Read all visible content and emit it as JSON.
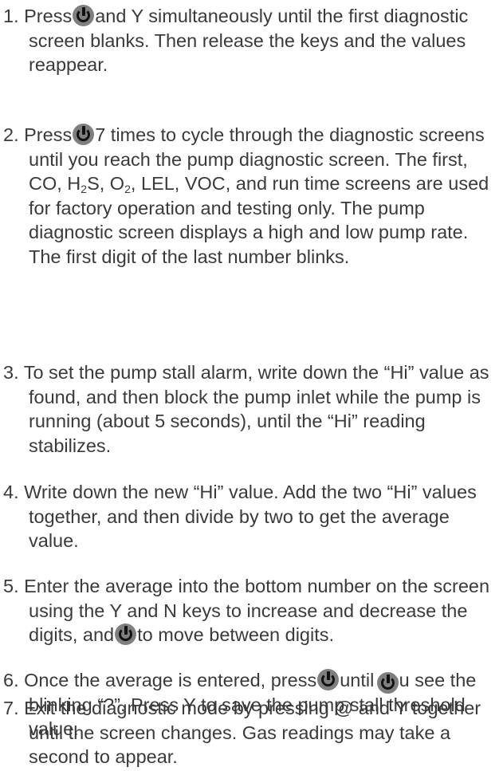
{
  "steps": [
    {
      "a": "1. Press",
      "b": "and Y simultaneously until the first diagnostic screen blanks. Then release the keys and the values reappear."
    },
    {
      "a": "2. Press",
      "b": "7 times to cycle through the diagnostic screens until you reach the pump diagnostic screen. The first, CO, H",
      "sub1": "2",
      "c": "S, O",
      "sub2": "2",
      "d": ", LEL, VOC, and run time screens are used for factory operation and testing only. The pump diagnostic screen displays a high and low pump rate. The first digit of the last number blinks."
    },
    {
      "a": "3. To set the pump stall alarm, write down the “Hi” value as found, and then block the pump inlet while the pump is running (about 5 seconds), until the “Hi” reading stabilizes."
    },
    {
      "a": "4. Write down the new “Hi” value. Add the two “Hi” values together, and then divide by two to get the average value."
    },
    {
      "a": "5. Enter the average into the bottom number on the screen using the Y and N keys to increase and decrease the digits, and",
      "b": "to move between digits."
    },
    {
      "a": "6. Once the average is entered, press",
      "b": "until you see the blinking “?”. Press Y to save the pump stall threshold value."
    },
    {
      "a": "7. Exit the diagnostic mode by pressing @ and Y together until the screen changes. Gas readings may take a second to appear."
    }
  ],
  "icons": {
    "power": "power-button-icon"
  },
  "colors": {
    "text": "#3a3a3a",
    "icon_bg": "#7f7f7f",
    "icon_fg": "#111111"
  }
}
